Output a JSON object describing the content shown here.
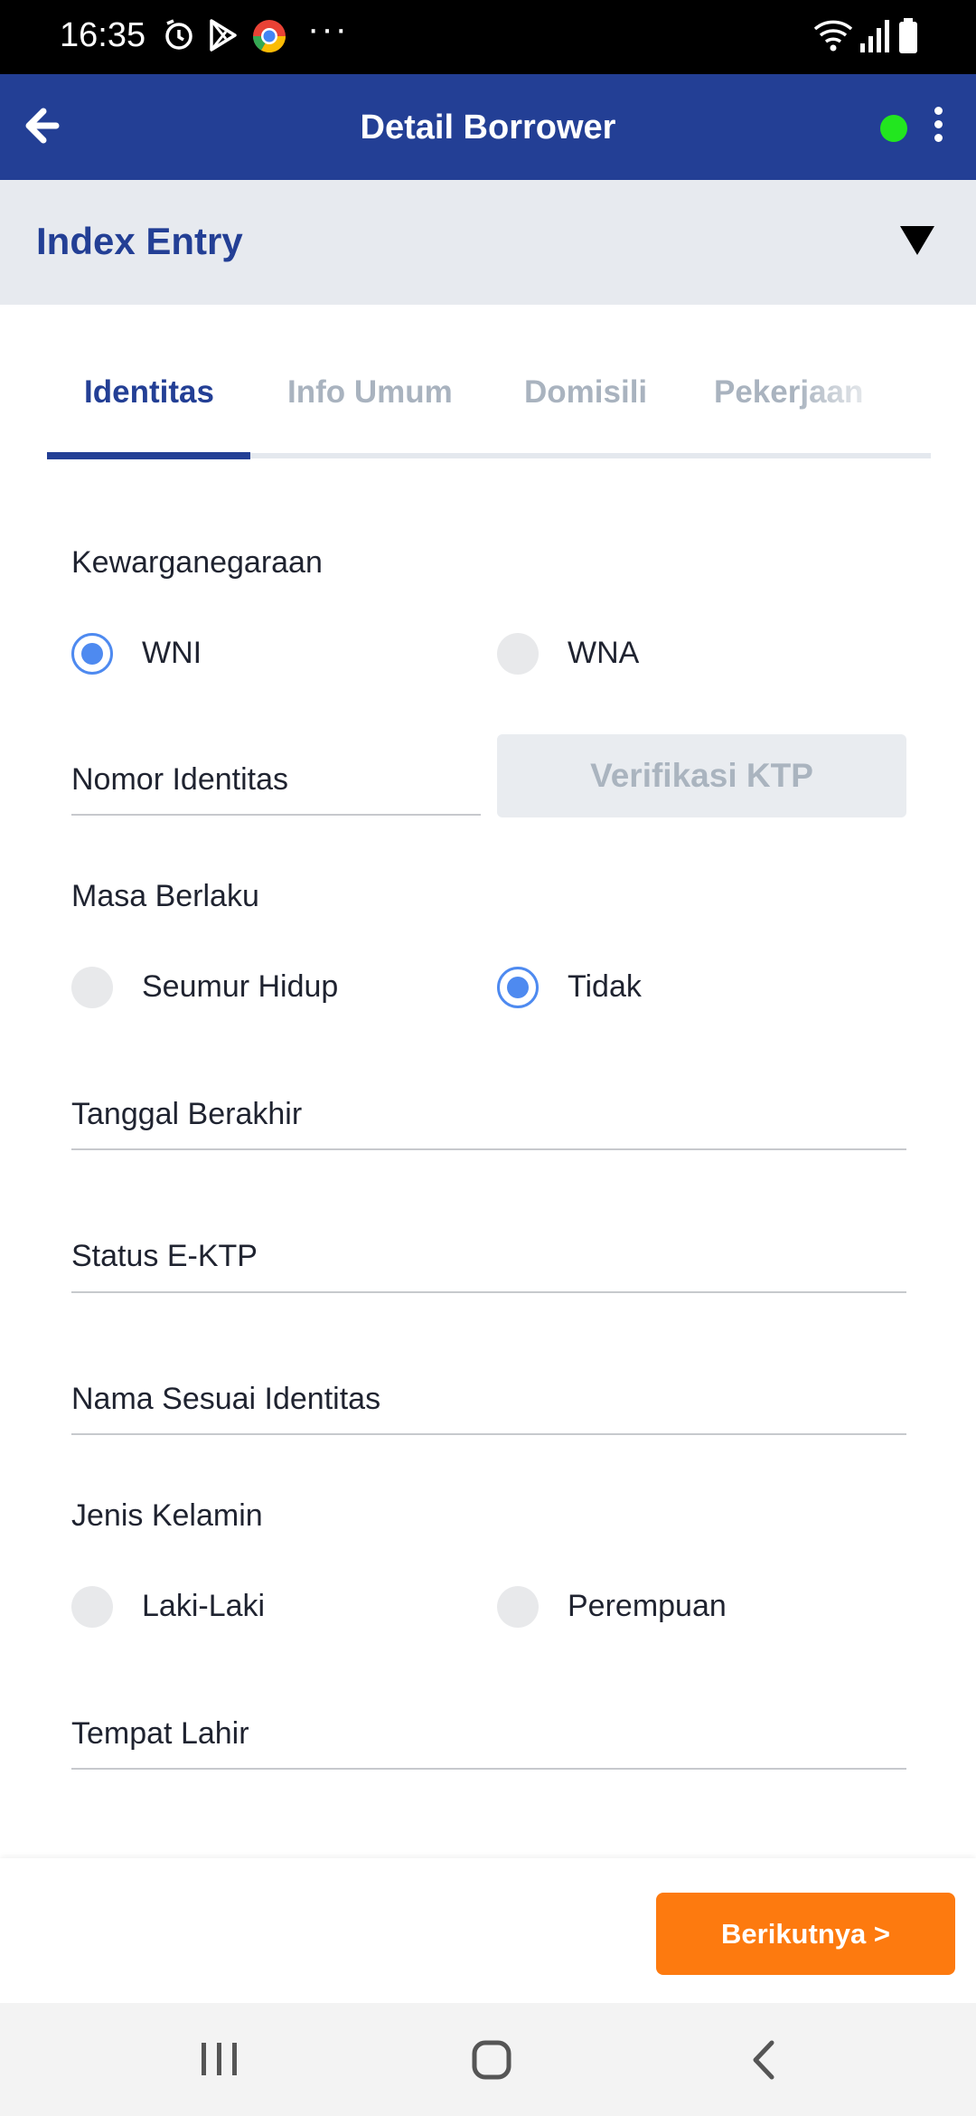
{
  "status_bar": {
    "time": "16:35",
    "icons": [
      "alarm-sync-icon",
      "play-store-icon",
      "chrome-icon",
      "more-notifications-icon",
      "wifi-icon",
      "signal-icon",
      "battery-icon"
    ],
    "dots": "···"
  },
  "app_bar": {
    "title": "Detail Borrower",
    "online_color": "#22e61f",
    "brand_color": "#233f95"
  },
  "section": {
    "title": "Index Entry"
  },
  "tabs": [
    {
      "label": "Identitas",
      "active": true
    },
    {
      "label": "Info Umum",
      "active": false
    },
    {
      "label": "Domisili",
      "active": false
    },
    {
      "label": "Pekerjaan",
      "active": false
    }
  ],
  "form": {
    "citizenship": {
      "label": "Kewarganegaraan",
      "options": [
        {
          "label": "WNI",
          "selected": true
        },
        {
          "label": "WNA",
          "selected": false
        }
      ]
    },
    "id_number": {
      "label": "Nomor Identitas",
      "value": "",
      "verify_button": "Verifikasi KTP"
    },
    "validity": {
      "label": "Masa Berlaku",
      "options": [
        {
          "label": "Seumur Hidup",
          "selected": false
        },
        {
          "label": "Tidak",
          "selected": true
        }
      ]
    },
    "end_date": {
      "label": "Tanggal Berakhir",
      "value": ""
    },
    "ektp_status": {
      "label": "Status E-KTP",
      "value": ""
    },
    "name": {
      "label": "Nama Sesuai Identitas",
      "value": ""
    },
    "gender": {
      "label": "Jenis Kelamin",
      "options": [
        {
          "label": "Laki-Laki",
          "selected": false
        },
        {
          "label": "Perempuan",
          "selected": false
        }
      ]
    },
    "birth_place": {
      "label": "Tempat Lahir",
      "value": ""
    }
  },
  "footer": {
    "next_button": "Berikutnya >",
    "accent_color": "#fd7a0f"
  }
}
